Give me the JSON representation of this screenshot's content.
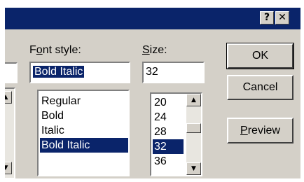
{
  "title_bar": {
    "help_button": "?",
    "close_button": "✕"
  },
  "font_style": {
    "label_prefix": "F",
    "label_underlined": "o",
    "label_rest": "nt style:",
    "value": "Bold Italic",
    "options": [
      "Regular",
      "Bold",
      "Italic",
      "Bold Italic"
    ],
    "selected_index": 3
  },
  "size": {
    "label_underlined": "S",
    "label_rest": "ize:",
    "value": "32",
    "options": [
      "20",
      "24",
      "28",
      "32",
      "36"
    ],
    "selected_index": 3
  },
  "buttons": {
    "ok": "OK",
    "cancel": "Cancel",
    "preview_underlined": "P",
    "preview_rest": "review"
  },
  "colors": {
    "title_bar": "#0a246a",
    "dialog_face": "#d4d0c8",
    "selection": "#0a246a"
  }
}
